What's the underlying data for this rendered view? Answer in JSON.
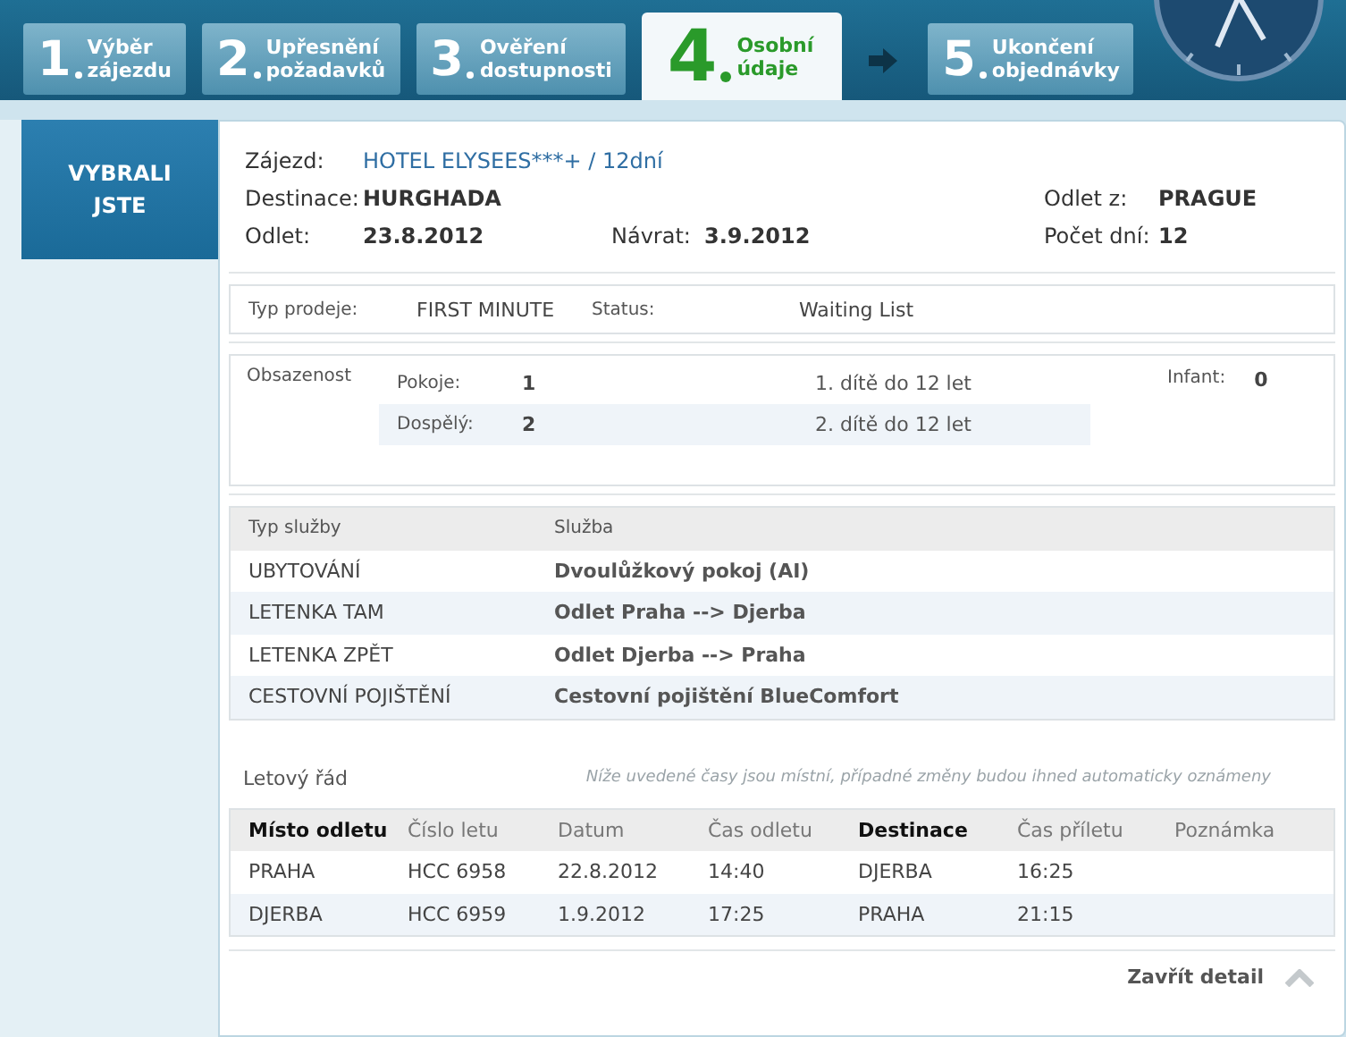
{
  "steps": [
    {
      "number": "1",
      "label": "Výběr\nzájezdu",
      "selected": false
    },
    {
      "number": "2",
      "label": "Upřesnění\npožadavků",
      "selected": false
    },
    {
      "number": "3",
      "label": "Ověření\ndostupnosti",
      "selected": false
    },
    {
      "number": "4",
      "label": "Osobní\núdaje",
      "selected": true
    },
    {
      "number": "5",
      "label": "Ukončení\nobjednávky",
      "selected": false
    }
  ],
  "side_heading": "VYBRALI\nJSTE",
  "summary": [
    {
      "left": {
        "label": "Zájezd:",
        "value": "HOTEL ELYSEES***+ / 12dní",
        "kind": "link"
      }
    },
    {
      "left": {
        "label": "Destinace:",
        "value": "HURGHADA"
      },
      "right": {
        "label": "Odlet z:",
        "value": "PRAGUE"
      }
    },
    {
      "left": {
        "label": "Odlet:",
        "value": "23.8.2012"
      },
      "middle": {
        "label": "Návrat:",
        "value": "3.9.2012"
      },
      "right": {
        "label": "Počet dní:",
        "value": "12"
      }
    }
  ],
  "sale": {
    "type_label": "Typ prodeje:",
    "type_value": "FIRST MINUTE",
    "status_label": "Status:",
    "status_value": "Waiting List"
  },
  "occupancy": {
    "title": "Obsazenost",
    "rows": [
      {
        "label": "Pokoje:",
        "value": "1",
        "child": "1. dítě do 12 let"
      },
      {
        "label": "Dospělý:",
        "value": "2",
        "child": "2. dítě do 12 let"
      }
    ],
    "infant_label": "Infant:",
    "infant_value": "0"
  },
  "services": {
    "columns": [
      "Typ služby",
      "Služba"
    ],
    "rows": [
      [
        "UBYTOVÁNÍ",
        "Dvoulůžkový pokoj (AI)"
      ],
      [
        "LETENKA TAM",
        "Odlet Praha --> Djerba"
      ],
      [
        "LETENKA ZPĚT",
        "Odlet Djerba --> Praha"
      ],
      [
        "CESTOVNÍ POJIŠTĚNÍ",
        "Cestovní pojištění BlueComfort"
      ]
    ]
  },
  "flights": {
    "title": "Letový řád",
    "note": "Níže uvedené časy jsou místní, případné změny budou ihned automaticky oznámeny",
    "columns": [
      {
        "label": "Místo odletu",
        "emphasized": true
      },
      {
        "label": "Číslo letu",
        "emphasized": false
      },
      {
        "label": "Datum",
        "emphasized": false
      },
      {
        "label": "Čas odletu",
        "emphasized": false
      },
      {
        "label": "Destinace",
        "emphasized": true
      },
      {
        "label": "Čas příletu",
        "emphasized": false
      },
      {
        "label": "Poznámka",
        "emphasized": false
      }
    ],
    "rows": [
      [
        "PRAHA",
        "HCC 6958",
        "22.8.2012",
        "14:40",
        "DJERBA",
        "16:25"
      ],
      [
        "DJERBA",
        "HCC 6959",
        "1.9.2012",
        "17:25",
        "PRAHA",
        "21:15"
      ]
    ]
  },
  "close_label": "Zavřít detail"
}
